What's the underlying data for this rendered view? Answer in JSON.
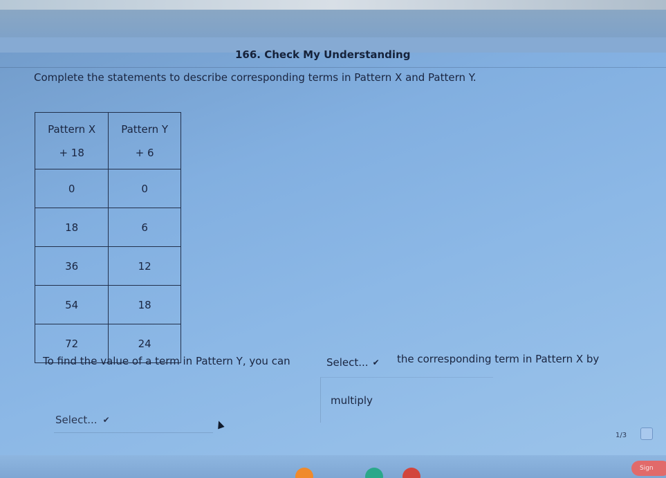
{
  "problem": {
    "title": "166. Check My Understanding",
    "prompt": "Complete the statements to describe corresponding terms in Pattern X and Pattern Y."
  },
  "table": {
    "headers": [
      {
        "name": "Pattern X",
        "rule": "+ 18"
      },
      {
        "name": "Pattern Y",
        "rule": "+ 6"
      }
    ],
    "rows": [
      [
        "0",
        "0"
      ],
      [
        "18",
        "6"
      ],
      [
        "36",
        "12"
      ],
      [
        "54",
        "18"
      ],
      [
        "72",
        "24"
      ]
    ]
  },
  "statement": {
    "before": "To find the value of a term in Pattern Y, you can",
    "select_1": "Select...",
    "after": "the corresponding term in Pattern X by",
    "dropdown_option": "multiply",
    "select_2": "Select..."
  },
  "footer": {
    "page_count": "1/3",
    "sign_label": "Sign"
  },
  "colors": {
    "background": "#82afe0",
    "text": "#1a2540",
    "sign_button": "#e16a6a"
  }
}
